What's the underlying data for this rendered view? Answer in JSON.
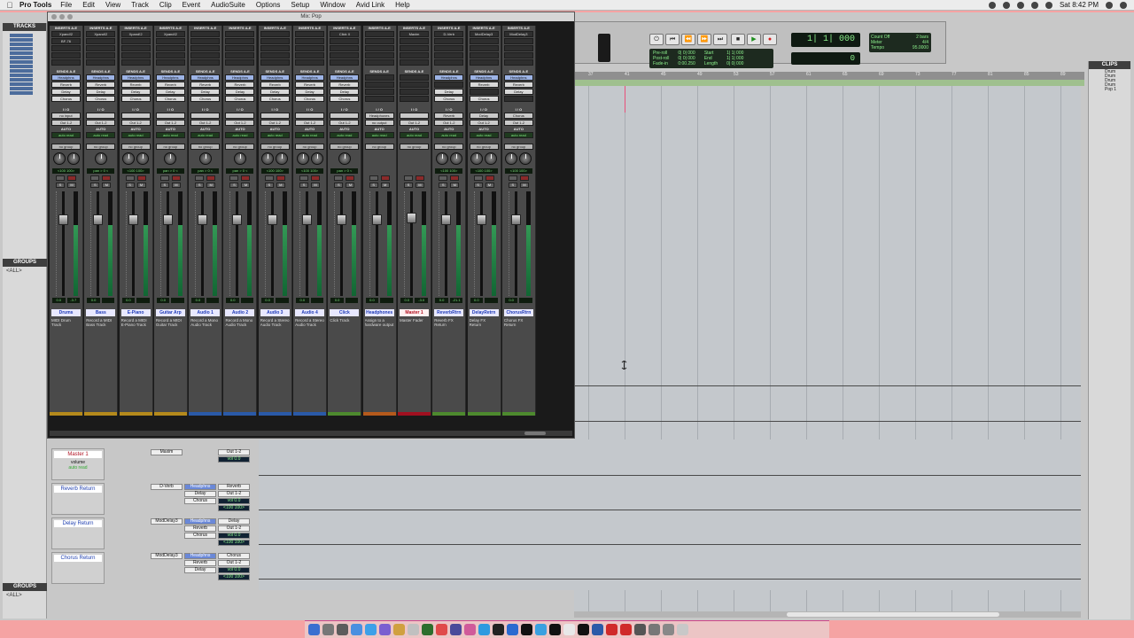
{
  "menubar": {
    "app": "Pro Tools",
    "items": [
      "File",
      "Edit",
      "View",
      "Track",
      "Clip",
      "Event",
      "AudioSuite",
      "Options",
      "Setup",
      "Window",
      "Avid Link",
      "Help"
    ],
    "clock": "Sat 8:42 PM"
  },
  "mix_window": {
    "title": "Mix: Pop",
    "strips": [
      {
        "name": "Drums",
        "insert": "Xpand!2",
        "insert2": "BF-76",
        "sends": [
          "Headphns",
          "Reverb",
          "Delay",
          "Chorus"
        ],
        "io_in": "no input",
        "io_out": "Out 1-2",
        "auto": "auto read",
        "group": "no group",
        "pan": "<100  100>",
        "vol": "0.0",
        "vol2": "-3.7",
        "comment": "MIDI Drum Track",
        "color": "#b58a1c",
        "type": "stereo"
      },
      {
        "name": "Bass",
        "insert": "Xpand!2",
        "insert2": "",
        "sends": [
          "Headphns",
          "Reverb",
          "Delay",
          "Chorus"
        ],
        "io_in": "",
        "io_out": "Out 1-2",
        "auto": "auto read",
        "group": "no group",
        "pan": "pan > 0 <",
        "vol": "0.0",
        "vol2": "",
        "comment": "Record a MIDI Bass Track",
        "color": "#b58a1c",
        "type": "mono"
      },
      {
        "name": "E-Piano",
        "insert": "Xpand!2",
        "insert2": "",
        "sends": [
          "Headphns",
          "Reverb",
          "Delay",
          "Chorus"
        ],
        "io_in": "",
        "io_out": "Out 1-2",
        "auto": "auto read",
        "group": "no group",
        "pan": "<100  100>",
        "vol": "0.0",
        "vol2": "",
        "comment": "Record a MIDI E-Piano Track",
        "color": "#b58a1c",
        "type": "stereo"
      },
      {
        "name": "Guitar Arp",
        "insert": "Xpand!2",
        "insert2": "",
        "sends": [
          "Headphns",
          "Reverb",
          "Delay",
          "Chorus"
        ],
        "io_in": "",
        "io_out": "Out 1-2",
        "auto": "auto read",
        "group": "no group",
        "pan": "pan > 0 <",
        "vol": "0.0",
        "vol2": "",
        "comment": "Record a MIDI Guitar Track",
        "color": "#b58a1c",
        "type": "mono"
      },
      {
        "name": "Audio 1",
        "insert": "",
        "insert2": "",
        "sends": [
          "Headphns",
          "Reverb",
          "Delay",
          "Chorus"
        ],
        "io_in": "",
        "io_out": "Out 1-2",
        "auto": "auto read",
        "group": "no group",
        "pan": "pan > 0 <",
        "vol": "0.0",
        "vol2": "",
        "comment": "Record a Mono Audio Track",
        "color": "#2a5aa8",
        "type": "mono"
      },
      {
        "name": "Audio 2",
        "insert": "",
        "insert2": "",
        "sends": [
          "Headphns",
          "Reverb",
          "Delay",
          "Chorus"
        ],
        "io_in": "",
        "io_out": "Out 1-2",
        "auto": "auto read",
        "group": "no group",
        "pan": "pan > 0 <",
        "vol": "0.0",
        "vol2": "",
        "comment": "Record a Mono Audio Track",
        "color": "#2a5aa8",
        "type": "mono"
      },
      {
        "name": "Audio 3",
        "insert": "",
        "insert2": "",
        "sends": [
          "Headphns",
          "Reverb",
          "Delay",
          "Chorus"
        ],
        "io_in": "",
        "io_out": "Out 1-2",
        "auto": "auto read",
        "group": "no group",
        "pan": "<100  100>",
        "vol": "0.0",
        "vol2": "",
        "comment": "Record a Stereo Audio Track",
        "color": "#2a5aa8",
        "type": "stereo"
      },
      {
        "name": "Audio 4",
        "insert": "",
        "insert2": "",
        "sends": [
          "Headphns",
          "Reverb",
          "Delay",
          "Chorus"
        ],
        "io_in": "",
        "io_out": "Out 1-2",
        "auto": "auto read",
        "group": "no group",
        "pan": "<100  100>",
        "vol": "0.0",
        "vol2": "",
        "comment": "Record a Stereo Audio Track",
        "color": "#2a5aa8",
        "type": "stereo"
      },
      {
        "name": "Click",
        "insert": "Click II",
        "insert2": "",
        "sends": [
          "Headphns",
          "Reverb",
          "Delay",
          "Chorus"
        ],
        "io_in": "",
        "io_out": "Out 1-2",
        "auto": "auto read",
        "group": "no group",
        "pan": "pan > 0 <",
        "vol": "0.0",
        "vol2": "",
        "comment": "Click Track",
        "color": "#4d8a2e",
        "type": "mono"
      },
      {
        "name": "Headphones",
        "insert": "",
        "insert2": "",
        "sends": [],
        "io_in": "Headphones",
        "io_out": "no output",
        "auto": "auto read",
        "group": "no group",
        "pan": "",
        "vol": "0.0",
        "vol2": "",
        "comment": "Assign to a hardware output",
        "color": "#b55a1c",
        "type": "aux"
      },
      {
        "name": "Master 1",
        "insert": "Maxim",
        "insert2": "",
        "sends": [],
        "io_in": "",
        "io_out": "Out 1-2",
        "auto": "auto read",
        "group": "no group",
        "pan": "",
        "vol": "0.0",
        "vol2": "-3.0",
        "comment": "Master Fader",
        "color": "#a01020",
        "type": "master"
      },
      {
        "name": "ReverbRtrn",
        "insert": "D-Verb",
        "insert2": "",
        "sends": [
          "Headphns",
          "",
          "Delay",
          "Chorus"
        ],
        "io_in": "Reverb",
        "io_out": "Out 1-2",
        "auto": "auto read",
        "group": "no group",
        "pan": "<100  100>",
        "vol": "0.0",
        "vol2": "-21.1",
        "comment": "Reverb FX Return",
        "color": "#4d8a2e",
        "type": "stereo"
      },
      {
        "name": "DelayRetrn",
        "insert": "ModDelay3",
        "insert2": "",
        "sends": [
          "Headphns",
          "Reverb",
          "",
          "Chorus"
        ],
        "io_in": "Delay",
        "io_out": "Out 1-2",
        "auto": "auto read",
        "group": "no group",
        "pan": "<100  100>",
        "vol": "0.0",
        "vol2": "",
        "comment": "Delay FX Return",
        "color": "#4d8a2e",
        "type": "stereo"
      },
      {
        "name": "ChorusRtrn",
        "insert": "ModDelay3",
        "insert2": "",
        "sends": [
          "Headphns",
          "Reverb",
          "Delay",
          ""
        ],
        "io_in": "Chorus",
        "io_out": "Out 1-2",
        "auto": "auto read",
        "group": "no group",
        "pan": "<100  100>",
        "vol": "0.0",
        "vol2": "",
        "comment": "Chorus FX Return",
        "color": "#4d8a2e",
        "type": "stereo"
      }
    ],
    "labels": {
      "inserts": "INSERTS A-E",
      "sends": "SENDS A-E",
      "io": "I / O",
      "auto": "AUTO"
    }
  },
  "edit_window": {
    "tracks_label": "TRACKS",
    "groups_label": "GROUPS",
    "all_label": "<ALL>",
    "clips_label": "CLIPS",
    "track_list": [
      "Drm",
      "Bss",
      "EPn",
      "Gtr",
      "Ad1",
      "Ad2",
      "Ad3",
      "Ad4",
      "Clk",
      "Hdp",
      "Ms1",
      "Rtr",
      "Dtr",
      "Chr"
    ],
    "clips": [
      "Drum",
      "Drum",
      "Drum",
      "Drum",
      "Pop 1"
    ],
    "ruler_ticks": [
      "37",
      "41",
      "45",
      "49",
      "53",
      "57",
      "61",
      "65",
      "69",
      "73",
      "77",
      "81",
      "85",
      "89"
    ],
    "lower_tracks": [
      {
        "name": "Master 1",
        "sub": "volume",
        "auto": "auto read",
        "insert": "Maxim",
        "io": [
          "Out 1-2",
          "vol  0.0"
        ],
        "master": true
      },
      {
        "name": "Reverb Return",
        "insert": "D-Verb",
        "send": "Headphns",
        "io": [
          "Reverb",
          "Out 1-2",
          "vol  0.0",
          "<100  100>"
        ],
        "sends2": [
          "Delay",
          "Chorus"
        ],
        "master": false
      },
      {
        "name": "Delay Return",
        "insert": "ModDelay3",
        "send": "Headphns",
        "io": [
          "Delay",
          "Out 1-2",
          "vol  0.0",
          "<100  100>"
        ],
        "sends2": [
          "Reverb",
          "Chorus"
        ],
        "master": false
      },
      {
        "name": "Chorus Return",
        "insert": "ModDelay3",
        "send": "Headphns",
        "io": [
          "Chorus",
          "Out 1-2",
          "vol  0.0",
          "<100  100>"
        ],
        "sends2": [
          "Reverb",
          "Delay"
        ],
        "master": false
      }
    ]
  },
  "transport": {
    "main_counter": "1| 1| 000",
    "sub_counter": "0",
    "pre_roll": "Pre-roll",
    "post_roll": "Post-roll",
    "fade_in": "Fade-in",
    "pre_vals": [
      "0| 0| 000",
      "0| 0| 000",
      "0:00.250"
    ],
    "start_lbl": "Start",
    "end_lbl": "End",
    "length_lbl": "Length",
    "start_vals": [
      "1| 1| 000",
      "1| 1| 000",
      "0| 0| 000"
    ],
    "count_off": "Count Off",
    "meter": "Meter",
    "tempo": "Tempo",
    "bars": "2 bars",
    "time_sig": "4/4",
    "bpm": "95.0000"
  },
  "dock_colors": [
    "#3a6fd0",
    "#777",
    "#5c5c5c",
    "#4a8fe0",
    "#3da0e8",
    "#7a5fd0",
    "#d0a040",
    "#c0c0c0",
    "#2d6e2d",
    "#e04a4a",
    "#4a4a9a",
    "#d05a9a",
    "#2d9ae0",
    "#222",
    "#2a6ad0",
    "#111",
    "#3aa0e0",
    "#111",
    "#e8e8e8",
    "#111",
    "#2a5aa8",
    "#d02a2a",
    "#d02a2a",
    "#555",
    "#777",
    "#888",
    "#c8c8c8"
  ]
}
